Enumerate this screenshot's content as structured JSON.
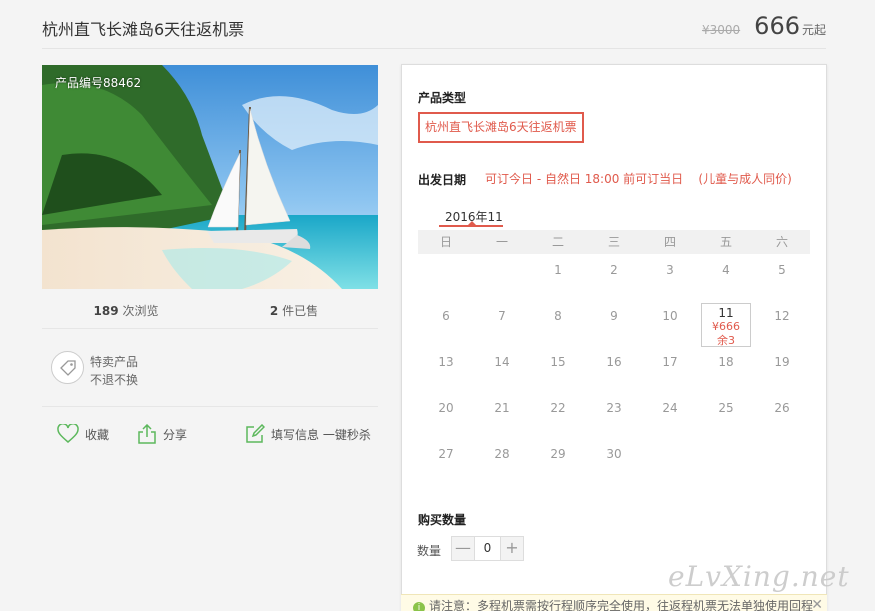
{
  "header": {
    "title": "杭州直飞长滩岛6天往返机票",
    "old_price": "¥3000",
    "price": "666",
    "price_unit": "元起"
  },
  "product": {
    "number_label": "产品编号88462",
    "views_count": "189",
    "views_label": "次浏览",
    "sold_count": "2",
    "sold_label": "件已售",
    "special_title": "特卖产品",
    "special_sub": "不退不换"
  },
  "actions": {
    "favorite": "收藏",
    "share": "分享",
    "fill_info": "填写信息 一键秒杀"
  },
  "booking": {
    "type_label": "产品类型",
    "type_option": "杭州直飞长滩岛6天往返机票",
    "date_label": "出发日期",
    "date_note": "可订今日 - 自然日 18:00 前可订当日    (儿童与成人同价)",
    "month_tab": "2016年11",
    "weekdays": [
      "日",
      "一",
      "二",
      "三",
      "四",
      "五",
      "六"
    ],
    "weeks": [
      [
        "",
        "",
        "1",
        "2",
        "3",
        "4",
        "5"
      ],
      [
        "6",
        "7",
        "8",
        "9",
        "10",
        "11",
        "12"
      ],
      [
        "13",
        "14",
        "15",
        "16",
        "17",
        "18",
        "19"
      ],
      [
        "20",
        "21",
        "22",
        "23",
        "24",
        "25",
        "26"
      ],
      [
        "27",
        "28",
        "29",
        "30",
        "",
        "",
        ""
      ]
    ],
    "available_day": {
      "day": "11",
      "price": "¥666",
      "stock": "余3"
    },
    "qty_section_label": "购买数量",
    "qty_label": "数量",
    "qty_minus": "—",
    "qty_value": "0",
    "qty_plus": "+"
  },
  "notice": {
    "icon": "i",
    "text": "请注意：多程机票需按行程顺序完全使用，往返程机票无法单独使用回程",
    "close": "✕"
  },
  "watermark": "eLvXing.net",
  "colors": {
    "accent": "#e05a4c",
    "action_icon": "#5cb85c"
  }
}
